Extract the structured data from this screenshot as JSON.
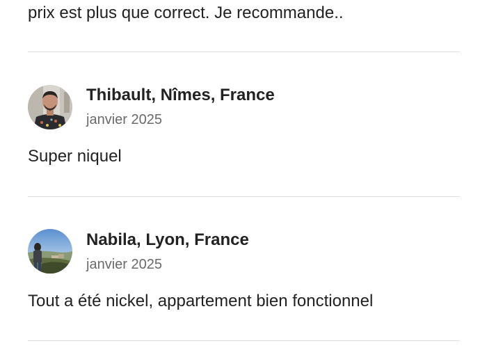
{
  "previous_review": {
    "text_tail": "prix est plus que correct. Je recommande.."
  },
  "reviews": [
    {
      "avatar": "avatar-man-selfie",
      "name": "Thibault, Nîmes, France",
      "date": "janvier 2025",
      "text": "Super niquel"
    },
    {
      "avatar": "avatar-woman-landscape",
      "name": "Nabila, Lyon, France",
      "date": "janvier 2025",
      "text": "Tout a été nickel, appartement bien fonctionnel"
    }
  ],
  "colors": {
    "text_primary": "#222222",
    "text_secondary": "#6a6a6a",
    "divider": "#dddddd",
    "background": "#ffffff"
  }
}
